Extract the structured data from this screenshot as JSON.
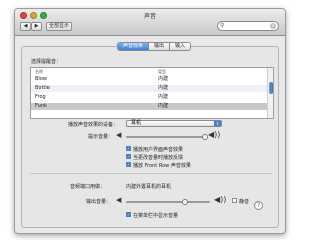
{
  "window": {
    "title": "声音",
    "show_all_label": "全部显示",
    "search_placeholder": ""
  },
  "tabs": [
    {
      "label": "声音效果",
      "active": true
    },
    {
      "label": "输出",
      "active": false
    },
    {
      "label": "输入",
      "active": false
    }
  ],
  "alert_section": {
    "heading": "选择提醒音：",
    "columns": [
      "名称",
      "类型"
    ],
    "rows": [
      {
        "name": "Blow",
        "type": "内建",
        "selected": false
      },
      {
        "name": "Bottle",
        "type": "内建",
        "selected": false
      },
      {
        "name": "Frog",
        "type": "内建",
        "selected": false
      },
      {
        "name": "Funk",
        "type": "内建",
        "selected": true
      }
    ]
  },
  "play_device": {
    "label": "播放声音效果的设备：",
    "value": "耳机"
  },
  "alert_volume": {
    "label": "提示音量：",
    "level": 0.72
  },
  "checkboxes": [
    {
      "label": "播放用户界面声音效果",
      "checked": true
    },
    {
      "label": "当更改音量时播放反馈",
      "checked": true
    },
    {
      "label": "播放 Front Row 声音效果",
      "checked": true
    }
  ],
  "headphones": {
    "label": "音频端口用做：",
    "value": "内建外置耳机的耳机"
  },
  "output_volume": {
    "label": "输出音量：",
    "level": 0.68,
    "mute_label": "静音",
    "muted": false
  },
  "menu_bar_volume": {
    "label": "在菜单栏中显示音量",
    "checked": true
  }
}
